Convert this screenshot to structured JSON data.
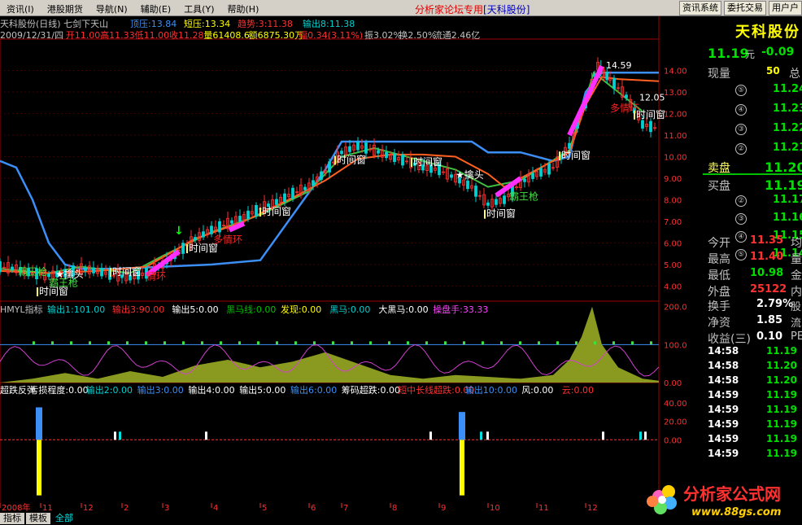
{
  "menu": {
    "items": [
      "资讯(I)",
      "港股期货",
      "导航(N)",
      "辅助(E)",
      "工具(Y)",
      "帮助(H)"
    ],
    "center_title": "分析家论坛专用",
    "center_title_bracket": "[天科股份]",
    "buttons": [
      "资讯系统",
      "委托交易",
      "用户户"
    ]
  },
  "chart_data": [
    {
      "type": "candlestick",
      "panel": "main",
      "title": "天科股份(日线)",
      "indicator_name": "七剑下天山",
      "legend": [
        {
          "text": "顶压:13.84",
          "color": "#3b8ff6"
        },
        {
          "text": "短压:13.34",
          "color": "#ffff00"
        },
        {
          "text": "趋势:3:11.38",
          "color": "#ff3030"
        },
        {
          "text": "输出8:11.38",
          "color": "#00d0d0"
        }
      ],
      "info_line": {
        "date": "2009/12/31/四",
        "open": "开11.00",
        "high": "高11.33",
        "low": "低11.00",
        "close": "收11.28",
        "volume": "量61408.6",
        "amount": "额6875.30万",
        "amplitude": "幅0.34(3.11%)",
        "zhen": "振3.02%",
        "turnover": "换2.50%",
        "float": "流通2.46亿"
      },
      "y_ticks": [
        "14.00",
        "13.00",
        "12.00",
        "11.00",
        "10.00",
        "9.00",
        "8.00",
        "7.00",
        "6.00",
        "5.00",
        "4.00"
      ],
      "ylim": [
        3.3,
        14.7
      ],
      "price_path": [
        [
          0,
          4.9
        ],
        [
          20,
          4.8
        ],
        [
          40,
          4.6
        ],
        [
          60,
          4.5
        ],
        [
          80,
          4.6
        ],
        [
          100,
          4.8
        ],
        [
          120,
          4.7
        ],
        [
          140,
          4.5
        ],
        [
          160,
          4.4
        ],
        [
          180,
          4.6
        ],
        [
          200,
          5.0
        ],
        [
          220,
          5.6
        ],
        [
          240,
          6.2
        ],
        [
          260,
          6.6
        ],
        [
          280,
          6.9
        ],
        [
          300,
          7.2
        ],
        [
          320,
          7.6
        ],
        [
          340,
          7.9
        ],
        [
          360,
          8.3
        ],
        [
          380,
          8.6
        ],
        [
          400,
          9.3
        ],
        [
          420,
          10.2
        ],
        [
          440,
          10.5
        ],
        [
          460,
          10.3
        ],
        [
          480,
          10.0
        ],
        [
          500,
          9.8
        ],
        [
          520,
          9.5
        ],
        [
          540,
          9.4
        ],
        [
          560,
          9.0
        ],
        [
          580,
          8.6
        ],
        [
          600,
          7.8
        ],
        [
          620,
          8.0
        ],
        [
          640,
          8.8
        ],
        [
          660,
          9.2
        ],
        [
          680,
          9.5
        ],
        [
          700,
          10.5
        ],
        [
          720,
          12.5
        ],
        [
          735,
          14.2
        ],
        [
          750,
          13.6
        ],
        [
          770,
          12.8
        ],
        [
          790,
          11.5
        ],
        [
          810,
          11.3
        ]
      ],
      "line_blue": [
        [
          0,
          9.8
        ],
        [
          20,
          9.5
        ],
        [
          40,
          8.0
        ],
        [
          60,
          6.0
        ],
        [
          80,
          5.0
        ],
        [
          100,
          4.8
        ],
        [
          140,
          4.8
        ],
        [
          200,
          4.9
        ],
        [
          260,
          5.0
        ],
        [
          320,
          5.2
        ],
        [
          400,
          9.4
        ],
        [
          420,
          10.7
        ],
        [
          460,
          10.7
        ],
        [
          500,
          10.7
        ],
        [
          540,
          10.7
        ],
        [
          580,
          10.7
        ],
        [
          600,
          10.2
        ],
        [
          640,
          10.2
        ],
        [
          680,
          9.8
        ],
        [
          700,
          10.0
        ],
        [
          720,
          13.0
        ],
        [
          740,
          13.9
        ],
        [
          810,
          13.9
        ]
      ],
      "line_orange": [
        [
          0,
          4.7
        ],
        [
          60,
          4.6
        ],
        [
          120,
          4.7
        ],
        [
          180,
          4.9
        ],
        [
          240,
          6.2
        ],
        [
          300,
          7.0
        ],
        [
          360,
          8.1
        ],
        [
          400,
          8.9
        ],
        [
          440,
          9.9
        ],
        [
          480,
          10.1
        ],
        [
          520,
          10.1
        ],
        [
          560,
          10.0
        ],
        [
          600,
          9.2
        ],
        [
          620,
          8.6
        ],
        [
          660,
          9.4
        ],
        [
          700,
          10.2
        ],
        [
          720,
          12.4
        ],
        [
          740,
          13.7
        ],
        [
          760,
          13.6
        ],
        [
          810,
          13.5
        ]
      ],
      "line_green": [
        [
          0,
          4.8
        ],
        [
          60,
          4.6
        ],
        [
          100,
          4.9
        ],
        [
          160,
          4.6
        ],
        [
          200,
          5.4
        ],
        [
          260,
          6.5
        ],
        [
          320,
          7.3
        ],
        [
          380,
          8.4
        ],
        [
          420,
          10.0
        ],
        [
          460,
          10.4
        ],
        [
          520,
          9.8
        ],
        [
          560,
          9.4
        ],
        [
          600,
          8.6
        ],
        [
          640,
          8.9
        ],
        [
          700,
          10.3
        ],
        [
          730,
          13.9
        ],
        [
          760,
          13.0
        ],
        [
          790,
          12.1
        ]
      ],
      "annotations": [
        {
          "text": "时间窗",
          "x": 48,
          "y": 3.6
        },
        {
          "text": "时间窗",
          "x": 138,
          "y": 4.5
        },
        {
          "text": "时间窗",
          "x": 232,
          "y": 5.6
        },
        {
          "text": "时间窗",
          "x": 322,
          "y": 7.3
        },
        {
          "text": "时间窗",
          "x": 414,
          "y": 9.7
        },
        {
          "text": "时间窗",
          "x": 508,
          "y": 9.6
        },
        {
          "text": "时间窗",
          "x": 598,
          "y": 7.2
        },
        {
          "text": "时间窗",
          "x": 690,
          "y": 9.9
        },
        {
          "text": "时间窗",
          "x": 782,
          "y": 11.8
        }
      ],
      "red_labels": [
        {
          "text": "多情环",
          "x": 262,
          "y": 6.0
        },
        {
          "text": "情环",
          "x": 180,
          "y": 4.3
        },
        {
          "text": "多情环",
          "x": 750,
          "y": 12.1
        }
      ],
      "green_labels": [
        {
          "text": "霸王枪",
          "x": 22,
          "y": 4.5
        },
        {
          "text": "霸王枪",
          "x": 626,
          "y": 8.0
        },
        {
          "text": "霸王枪",
          "x": 60,
          "y": 4.0
        }
      ],
      "star_labels": [
        {
          "text": "★擒头",
          "x": 68,
          "y": 4.4
        },
        {
          "text": "★擒头",
          "x": 560,
          "y": 9.0
        }
      ],
      "peak_label": "14.59",
      "peak_label_2": "12.05"
    },
    {
      "type": "area",
      "panel": "indicator1",
      "title": "HMYL指标",
      "legend": [
        {
          "text": "输出1:101.00",
          "color": "#00d0d0"
        },
        {
          "text": "输出3:90.00",
          "color": "#ff3030"
        },
        {
          "text": "输出5:0.00",
          "color": "#ffffff"
        },
        {
          "text": "黑马线:0.00",
          "color": "#00c000"
        },
        {
          "text": "发现:0.00",
          "color": "#ffff00"
        },
        {
          "text": "黑马:0.00",
          "color": "#00d0d0"
        },
        {
          "text": "大黑马:0.00",
          "color": "#ffffff"
        },
        {
          "text": "操盘手:33.33",
          "color": "#ff40ff"
        }
      ],
      "y_ticks": [
        "200.0",
        "100.0",
        "0.00"
      ],
      "ylim": [
        0,
        210
      ],
      "area_path": [
        [
          0,
          0
        ],
        [
          40,
          10
        ],
        [
          80,
          25
        ],
        [
          120,
          10
        ],
        [
          160,
          30
        ],
        [
          200,
          15
        ],
        [
          240,
          45
        ],
        [
          280,
          60
        ],
        [
          320,
          40
        ],
        [
          360,
          55
        ],
        [
          400,
          80
        ],
        [
          440,
          50
        ],
        [
          480,
          20
        ],
        [
          520,
          10
        ],
        [
          560,
          20
        ],
        [
          600,
          15
        ],
        [
          640,
          10
        ],
        [
          680,
          20
        ],
        [
          700,
          60
        ],
        [
          715,
          120
        ],
        [
          728,
          200
        ],
        [
          740,
          100
        ],
        [
          760,
          40
        ],
        [
          790,
          10
        ],
        [
          810,
          5
        ]
      ]
    },
    {
      "type": "bar",
      "panel": "indicator2",
      "legend": [
        {
          "text": "超跌反弹",
          "color": "#ffffff"
        },
        {
          "text": "亏损程度:0.00",
          "color": "#ffffff"
        },
        {
          "text": "输出2:0.00",
          "color": "#00d0d0"
        },
        {
          "text": "输出3:0.00",
          "color": "#3b8ff6"
        },
        {
          "text": "输出4:0.00",
          "color": "#ffffff"
        },
        {
          "text": "输出5:0.00",
          "color": "#ffffff"
        },
        {
          "text": "输出6:0.00",
          "color": "#3b8ff6"
        },
        {
          "text": "筹码超跌:0.00",
          "color": "#ffffff"
        },
        {
          "text": "短中长线超跌:0.00",
          "color": "#ff3030"
        },
        {
          "text": "输出10:0.00",
          "color": "#3b8ff6"
        },
        {
          "text": "风:0.00",
          "color": "#ffffff"
        },
        {
          "text": "云:0.00",
          "color": "#ff3030"
        }
      ],
      "y_ticks": [
        "40.00",
        "20.00",
        "0.00"
      ],
      "ylim": [
        -70,
        60
      ],
      "bars": [
        {
          "x": 48,
          "top": 35,
          "bottom": -60,
          "color": "#ffff00"
        },
        {
          "x": 568,
          "top": 30,
          "bottom": -60,
          "color": "#ffff00"
        }
      ]
    }
  ],
  "x_axis": {
    "labels": [
      "2008年",
      "11",
      "12",
      "2",
      "3",
      "4",
      "5",
      "6",
      "7",
      "8",
      "9",
      "10",
      "11",
      "12"
    ]
  },
  "quote": {
    "name": "天科股份",
    "price": "11.19",
    "unit": "元",
    "change": "-0.09",
    "xianliang_label": "现量",
    "xianliang_value": "50",
    "zong_label": "总",
    "sell": [
      {
        "n": "⑤",
        "price": "11.24"
      },
      {
        "n": "④",
        "price": "11.23"
      },
      {
        "n": "③",
        "price": "11.22"
      },
      {
        "n": "②",
        "price": "11.21"
      }
    ],
    "sell1_label": "卖盘",
    "sell1_price": "11.20",
    "buy1_label": "买盘",
    "buy1_price": "11.19",
    "buy": [
      {
        "n": "②",
        "price": "11.17"
      },
      {
        "n": "③",
        "price": "11.16"
      },
      {
        "n": "④",
        "price": "11.15"
      },
      {
        "n": "⑤",
        "price": "11.14"
      }
    ],
    "stats": [
      {
        "label": "今开",
        "value": "11.35",
        "color": "#ff3030"
      },
      {
        "label": "最高",
        "value": "11.40",
        "color": "#ff3030"
      },
      {
        "label": "最低",
        "value": "10.98",
        "color": "#00e000"
      },
      {
        "label": "外盘",
        "value": "25122",
        "color": "#ff3030"
      }
    ],
    "stats2": [
      {
        "label": "换手",
        "value": "2.79%",
        "color": "#ffffff",
        "tail": "股"
      },
      {
        "label": "净资",
        "value": "1.85",
        "color": "#ffffff",
        "tail": "流"
      },
      {
        "label": "收益(三)",
        "value": "0.10",
        "color": "#ffffff",
        "tail": "PE"
      }
    ],
    "ticks": [
      {
        "time": "14:58",
        "price": "11.19"
      },
      {
        "time": "14:58",
        "price": "11.20"
      },
      {
        "time": "14:58",
        "price": "11.20"
      },
      {
        "time": "14:59",
        "price": "11.19"
      },
      {
        "time": "14:59",
        "price": "11.19"
      },
      {
        "time": "14:59",
        "price": "11.19"
      },
      {
        "time": "14:59",
        "price": "11.19"
      },
      {
        "time": "14:59",
        "price": "11.19"
      }
    ],
    "extra_labels": [
      "均",
      "量",
      "金",
      "内"
    ]
  },
  "logo": {
    "text": "分析家公式网",
    "url": "www.88gs.com"
  },
  "tabs": [
    "指标",
    "模板",
    "全部"
  ]
}
